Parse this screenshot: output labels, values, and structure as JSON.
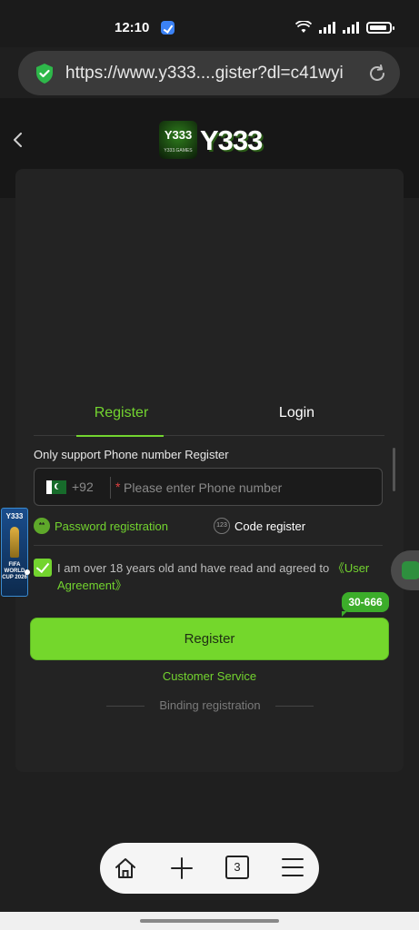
{
  "status_bar": {
    "time": "12:10"
  },
  "browser": {
    "url": "https://www.y333....gister?dl=c41wyi",
    "tab_count": "3"
  },
  "site": {
    "logo_badge": "Y333",
    "logo_badge_sub": "Y333.GAMES",
    "logo_text": "Y333"
  },
  "tabs": {
    "register": "Register",
    "login": "Login"
  },
  "form": {
    "support_text": "Only support Phone number Register",
    "country_code": "+92",
    "required_mark": "*",
    "phone_placeholder": "Please enter Phone number",
    "password_option": "Password registration",
    "password_option_icon": "**",
    "code_option": "Code register",
    "code_option_icon": "123",
    "agree_text": "I am over 18 years old and have read and agreed to ",
    "agree_link": "《User Agreement》",
    "agree_checked": true,
    "submit_label": "Register",
    "customer_service": "Customer Service",
    "binding": "Binding registration"
  },
  "promo": {
    "bubble": "30-666",
    "fifa_logo": "Y333",
    "fifa_text": "FIFA WORLD CUP 2026"
  },
  "colors": {
    "accent": "#73d42f",
    "background": "#1f1f1f",
    "card": "#232323"
  }
}
